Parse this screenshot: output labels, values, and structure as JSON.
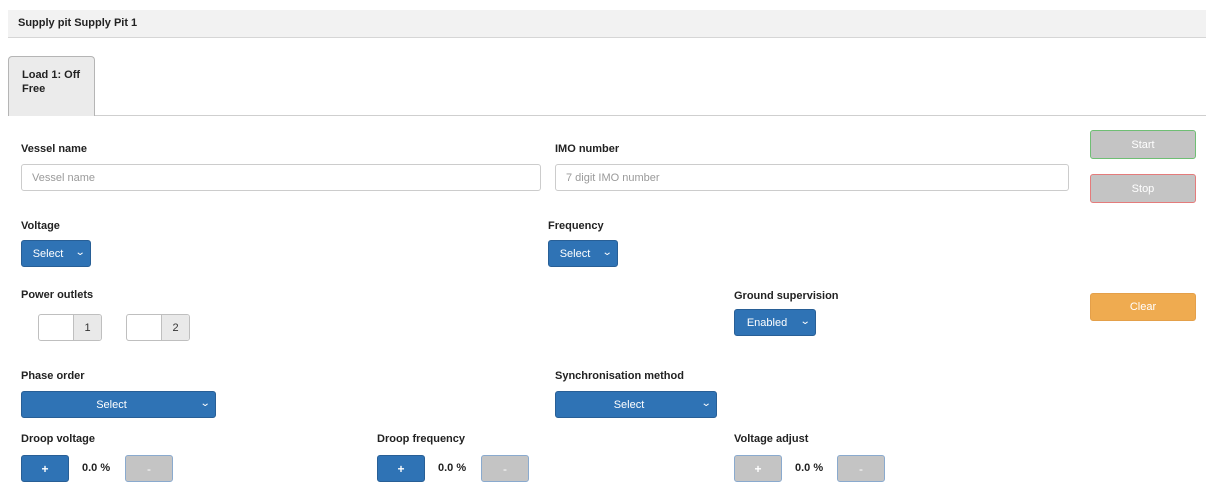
{
  "header": {
    "title": "Supply pit Supply Pit 1"
  },
  "tab": {
    "line1": "Load 1: Off",
    "line2": "Free"
  },
  "vessel": {
    "label": "Vessel name",
    "placeholder": "Vessel name",
    "value": ""
  },
  "imo": {
    "label": "IMO number",
    "placeholder": "7 digit IMO number",
    "value": ""
  },
  "actions": {
    "start": "Start",
    "stop": "Stop",
    "clear": "Clear"
  },
  "voltage": {
    "label": "Voltage",
    "selected": "Select"
  },
  "frequency": {
    "label": "Frequency",
    "selected": "Select"
  },
  "power_outlets": {
    "label": "Power outlets",
    "outlets": [
      "1",
      "2"
    ]
  },
  "ground_supervision": {
    "label": "Ground supervision",
    "selected": "Enabled"
  },
  "phase_order": {
    "label": "Phase order",
    "selected": "Select"
  },
  "sync_method": {
    "label": "Synchronisation method",
    "selected": "Select"
  },
  "droop_voltage": {
    "label": "Droop voltage",
    "value": "0.0 %",
    "plus": "+",
    "minus": "-"
  },
  "droop_frequency": {
    "label": "Droop frequency",
    "value": "0.0 %",
    "plus": "+",
    "minus": "-"
  },
  "voltage_adjust": {
    "label": "Voltage adjust",
    "value": "0.0 %",
    "plus": "+",
    "minus": "-"
  },
  "icons": {
    "dropdown": "chevron-down-icon"
  },
  "colors": {
    "primary": "#2f73b5",
    "warning": "#efab50",
    "disabled": "#c4c4c4",
    "success_border": "#6fbe74",
    "danger_border": "#e47b7b"
  }
}
